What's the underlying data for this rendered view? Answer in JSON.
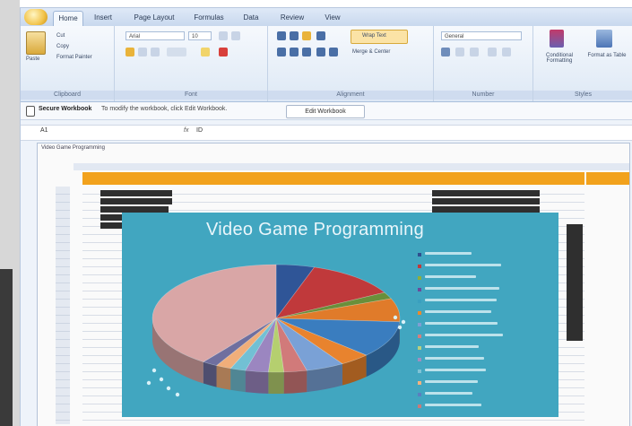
{
  "ribbon": {
    "tabs": [
      "Home",
      "Insert",
      "Page Layout",
      "Formulas",
      "Data",
      "Review",
      "View"
    ],
    "active_tab": "Home",
    "clipboard": {
      "paste": "Paste",
      "cut": "Cut",
      "copy": "Copy",
      "format_painter": "Format Painter",
      "label": "Clipboard"
    },
    "font": {
      "name": "Arial",
      "size": "10",
      "label": "Font"
    },
    "alignment": {
      "wrap_text": "Wrap Text",
      "merge": "Merge & Center",
      "label": "Alignment"
    },
    "number": {
      "format": "General",
      "label": "Number"
    },
    "styles": {
      "conditional": "Conditional Formatting",
      "format_table": "Format as Table",
      "label": "Styles"
    }
  },
  "protected_bar": {
    "title": "Secure Workbook",
    "message": "To modify the workbook, click Edit Workbook.",
    "button": "Edit Workbook"
  },
  "formula_bar": {
    "cell": "A1",
    "fx": "fx",
    "value": "ID"
  },
  "sheet": {
    "title": "Video Game Programming"
  },
  "chart": {
    "title": "Video Game Programming",
    "legend_colors": [
      "#2f4f8f",
      "#c0393b",
      "#8fae3a",
      "#6a4b9b",
      "#3a9fbf",
      "#e88a2e",
      "#7f9ed3",
      "#d47f7f",
      "#b7cf7f",
      "#a08fc0",
      "#7fc3d6",
      "#f2b27f",
      "#5b7fbf",
      "#c97a7a"
    ]
  },
  "chart_data": {
    "type": "pie",
    "title": "Video Game Programming",
    "slices": [
      {
        "color": "#2f5597",
        "value": 5
      },
      {
        "color": "#c0393b",
        "value": 12
      },
      {
        "color": "#6a8f3a",
        "value": 2
      },
      {
        "color": "#e07b2a",
        "value": 7
      },
      {
        "color": "#3a7dbf",
        "value": 11
      },
      {
        "color": "#e8832e",
        "value": 4
      },
      {
        "color": "#7aa1d6",
        "value": 5
      },
      {
        "color": "#d17a7a",
        "value": 3
      },
      {
        "color": "#b5cf6f",
        "value": 2
      },
      {
        "color": "#9b86c0",
        "value": 3
      },
      {
        "color": "#72c0d4",
        "value": 2
      },
      {
        "color": "#f0ae7a",
        "value": 2
      },
      {
        "color": "#6f6f9f",
        "value": 2
      },
      {
        "color": "#d9a6a6",
        "value": 40
      }
    ],
    "legend_position": "right"
  }
}
